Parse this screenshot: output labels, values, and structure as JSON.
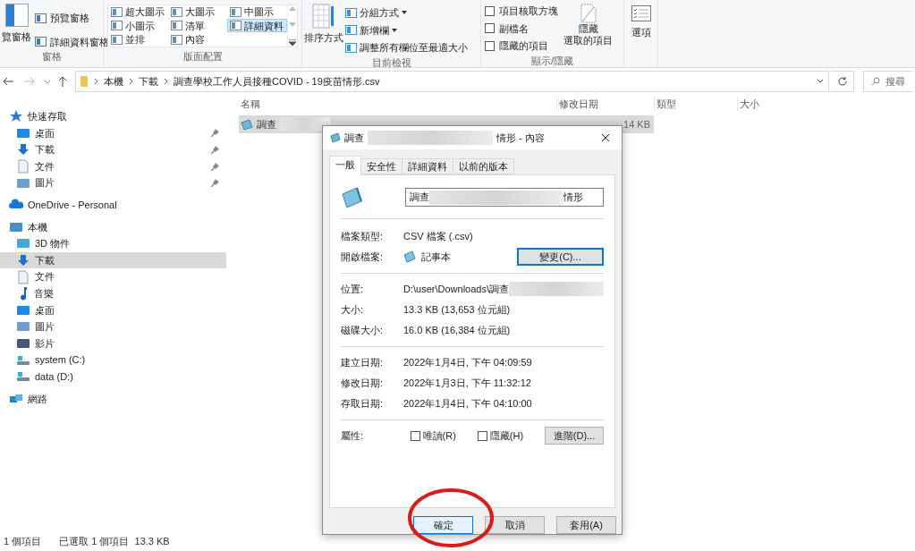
{
  "ribbon": {
    "panes": {
      "label": "窗格",
      "big": "覽窗格",
      "items": [
        "預覽窗格",
        "詳細資料窗格"
      ]
    },
    "layout": {
      "label": "版面配置",
      "options": [
        {
          "label": "超大圖示",
          "selected": false
        },
        {
          "label": "大圖示",
          "selected": false
        },
        {
          "label": "中圖示",
          "selected": false
        },
        {
          "label": "小圖示",
          "selected": false
        },
        {
          "label": "清單",
          "selected": false
        },
        {
          "label": "詳細資料",
          "selected": true
        },
        {
          "label": "並排",
          "selected": false
        },
        {
          "label": "內容",
          "selected": false
        }
      ]
    },
    "current_view": {
      "label": "目前檢視",
      "sort": "排序方式",
      "items": [
        {
          "label": "分組方式",
          "dropdown": true
        },
        {
          "label": "新增欄",
          "dropdown": true
        },
        {
          "label": "調整所有欄位至最適大小",
          "dropdown": false
        }
      ]
    },
    "show_hide": {
      "label": "顯示/隱藏",
      "checkboxes": [
        {
          "label": "項目核取方塊",
          "checked": false
        },
        {
          "label": "副檔名",
          "checked": false
        },
        {
          "label": "隱藏的項目",
          "checked": false
        }
      ],
      "hide_selected": [
        "隱藏",
        "選取的項目"
      ]
    },
    "options": "選項"
  },
  "address_bar": {
    "path": [
      "本機",
      "下載",
      "調查學校工作人員接種COVID - 19疫苗情形.csv"
    ],
    "search_placeholder": "搜尋"
  },
  "nav": [
    {
      "label": "快速存取",
      "kind": "star",
      "children": [
        {
          "label": "桌面",
          "kind": "desktop",
          "pinned": true,
          "selected": false
        },
        {
          "label": "下載",
          "kind": "download",
          "pinned": true,
          "selected": false
        },
        {
          "label": "文件",
          "kind": "document",
          "pinned": true,
          "selected": false
        },
        {
          "label": "圖片",
          "kind": "pictures",
          "pinned": true,
          "selected": false
        }
      ]
    },
    {
      "label": "OneDrive - Personal",
      "kind": "cloud"
    },
    {
      "label": "本機",
      "kind": "computer",
      "children": [
        {
          "label": "3D 物件",
          "kind": "cube",
          "pinned": false,
          "selected": false
        },
        {
          "label": "下載",
          "kind": "download",
          "pinned": false,
          "selected": true
        },
        {
          "label": "文件",
          "kind": "document",
          "pinned": false,
          "selected": false
        },
        {
          "label": "音樂",
          "kind": "music",
          "pinned": false,
          "selected": false
        },
        {
          "label": "桌面",
          "kind": "desktop",
          "pinned": false,
          "selected": false
        },
        {
          "label": "圖片",
          "kind": "pictures",
          "pinned": false,
          "selected": false
        },
        {
          "label": "影片",
          "kind": "video",
          "pinned": false,
          "selected": false
        },
        {
          "label": "system (C:)",
          "kind": "drive",
          "pinned": false,
          "selected": false
        },
        {
          "label": "data (D:)",
          "kind": "drive",
          "pinned": false,
          "selected": false
        }
      ]
    },
    {
      "label": "網路",
      "kind": "network"
    }
  ],
  "file_list": {
    "columns": [
      "名稱",
      "修改日期",
      "類型",
      "大小"
    ],
    "rows": [
      {
        "name": "調查",
        "size": "14 KB",
        "selected": true
      }
    ]
  },
  "dialog": {
    "title_start": "調查",
    "title_end": "情形 - 內容",
    "tabs": [
      {
        "label": "一般",
        "selected": true
      },
      {
        "label": "安全性",
        "selected": false
      },
      {
        "label": "詳細資料",
        "selected": false
      },
      {
        "label": "以前的版本",
        "selected": false
      }
    ],
    "name_start": "調查",
    "name_end": "情形",
    "file_type": {
      "label": "檔案類型:",
      "value": "CSV 檔案 (.csv)"
    },
    "opens_with": {
      "label": "開啟檔案:",
      "value": "記事本",
      "button": "變更(C)..."
    },
    "location": {
      "label": "位置:",
      "value": "D:\\user\\Downloads\\調查"
    },
    "size": {
      "label": "大小:",
      "value": "13.3 KB (13,653 位元組)"
    },
    "disk_size": {
      "label": "磁碟大小:",
      "value": "16.0 KB (16,384 位元組)"
    },
    "dates": [
      {
        "label": "建立日期:",
        "value": "2022年1月4日, 下午 04:09:59"
      },
      {
        "label": "修改日期:",
        "value": "2022年1月3日, 下午 11:32:12"
      },
      {
        "label": "存取日期:",
        "value": "2022年1月4日, 下午 04:10:00"
      }
    ],
    "attributes": {
      "label": "屬性:",
      "checkboxes": [
        {
          "label": "唯讀(R)",
          "checked": false
        },
        {
          "label": "隱藏(H)",
          "checked": false
        }
      ],
      "button": "進階(D)..."
    },
    "buttons": [
      {
        "label": "確定",
        "default": true
      },
      {
        "label": "取消",
        "default": false
      },
      {
        "label": "套用(A)",
        "default": false
      }
    ]
  },
  "status_bar": {
    "count": "1 個項目",
    "selection": "已選取 1 個項目  13.3 KB"
  }
}
